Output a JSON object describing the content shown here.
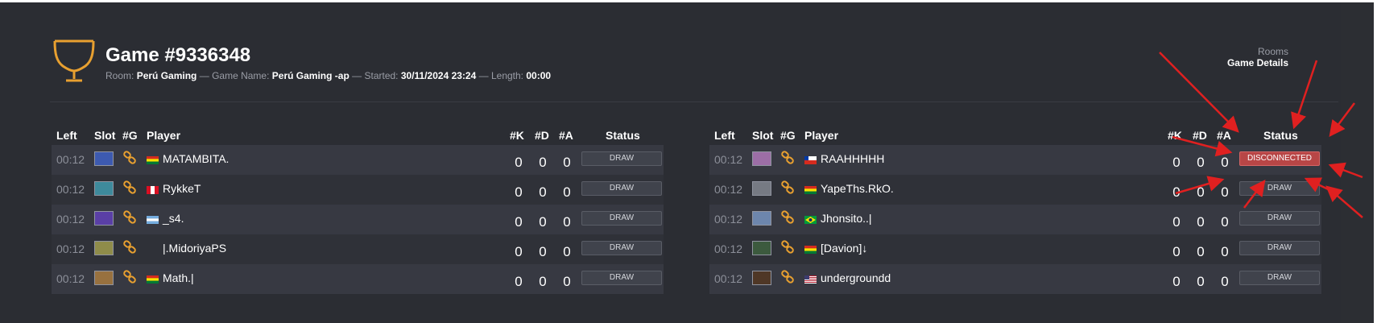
{
  "header": {
    "trophy_icon": "trophy-icon",
    "title": "Game #9336348",
    "room_label": "Room:",
    "room_value": "Perú Gaming",
    "sep1": "—",
    "game_name_label": "Game Name:",
    "game_name_value": "Perú Gaming -ap",
    "sep2": "—",
    "started_label": "Started:",
    "started_value": "30/11/2024 23:24",
    "sep3": "—",
    "length_label": "Length:",
    "length_value": "00:00"
  },
  "breadcrumb": {
    "rooms": "Rooms",
    "current": "Game Details"
  },
  "columns": {
    "left": "Left",
    "slot": "Slot",
    "g": "#G",
    "player": "Player",
    "k": "#K",
    "d": "#D",
    "a": "#A",
    "status": "Status"
  },
  "teams": [
    {
      "players": [
        {
          "left": "00:12",
          "slot_color": "#3d5ab0",
          "flag": "bolivia",
          "name": "MATAMBITA.",
          "k": "0",
          "d": "0",
          "a": "0",
          "status": "DRAW"
        },
        {
          "left": "00:12",
          "slot_color": "#3e8a9c",
          "flag": "peru",
          "name": "RykkeT",
          "k": "0",
          "d": "0",
          "a": "0",
          "status": "DRAW"
        },
        {
          "left": "00:12",
          "slot_color": "#5a3fa6",
          "flag": "argentina",
          "name": "_s4.",
          "k": "0",
          "d": "0",
          "a": "0",
          "status": "DRAW"
        },
        {
          "left": "00:12",
          "slot_color": "#8f8c4a",
          "flag": "none",
          "name": "|.MidoriyaPS",
          "k": "0",
          "d": "0",
          "a": "0",
          "status": "DRAW"
        },
        {
          "left": "00:12",
          "slot_color": "#98713f",
          "flag": "bolivia",
          "name": "Math.|",
          "k": "0",
          "d": "0",
          "a": "0",
          "status": "DRAW"
        }
      ]
    },
    {
      "players": [
        {
          "left": "00:12",
          "slot_color": "#9c6ea6",
          "flag": "chile",
          "name": "RAAHHHHH",
          "k": "0",
          "d": "0",
          "a": "0",
          "status": "DISCONNECTED"
        },
        {
          "left": "00:12",
          "slot_color": "#767a83",
          "flag": "bolivia",
          "name": "YapeThs.RkO.",
          "k": "0",
          "d": "0",
          "a": "0",
          "status": "DRAW"
        },
        {
          "left": "00:12",
          "slot_color": "#6d86ad",
          "flag": "brazil",
          "name": "Jhonsito..|",
          "k": "0",
          "d": "0",
          "a": "0",
          "status": "DRAW"
        },
        {
          "left": "00:12",
          "slot_color": "#3c5a3e",
          "flag": "bolivia",
          "name": "[Davion]↓",
          "k": "0",
          "d": "0",
          "a": "0",
          "status": "DRAW"
        },
        {
          "left": "00:12",
          "slot_color": "#4f3726",
          "flag": "usa",
          "name": "undergroundd",
          "k": "0",
          "d": "0",
          "a": "0",
          "status": "DRAW"
        }
      ]
    }
  ],
  "colors": {
    "accent": "#e8a030",
    "panel": "#2b2d33",
    "row_odd": "#373942",
    "row_even": "#2f3138",
    "disconnected": "#b84646",
    "annotation_arrow": "#e02020"
  }
}
